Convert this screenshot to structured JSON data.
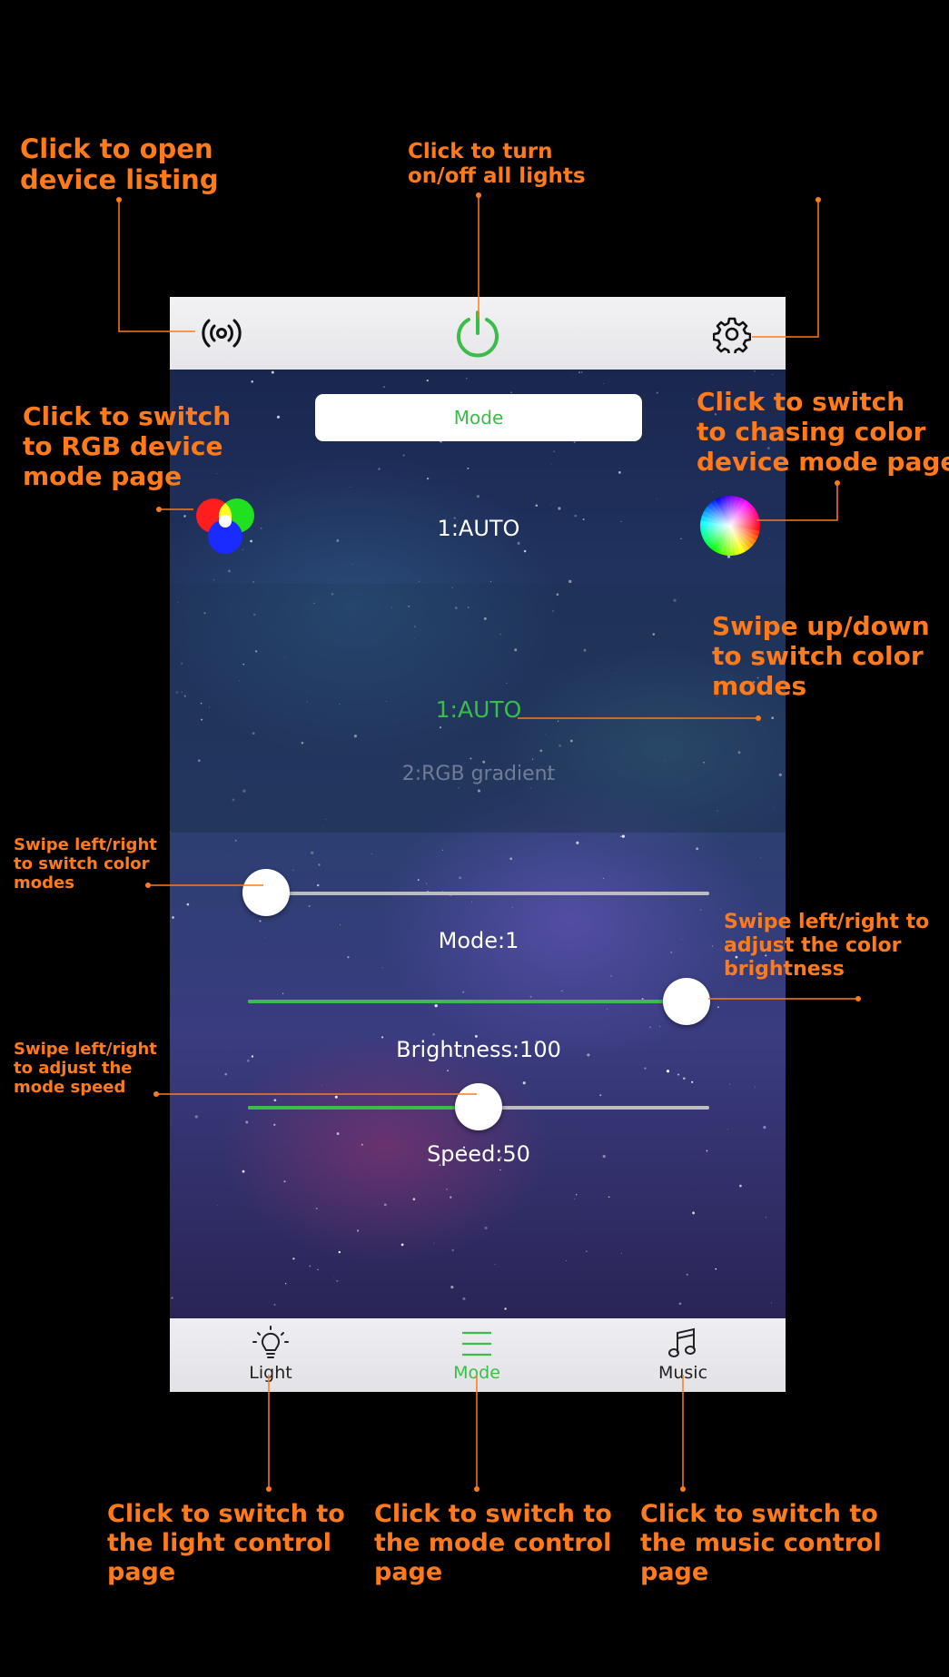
{
  "app": {
    "mode_button": "Mode",
    "current_mode": "1:AUTO",
    "picker": {
      "selected": "1:AUTO",
      "next": "2:RGB gradient"
    },
    "sliders": {
      "mode": {
        "label": "Mode:1",
        "value": 0.04
      },
      "brightness": {
        "label": "Brightness:100",
        "value": 0.95
      },
      "speed": {
        "label": "Speed:50",
        "value": 0.5
      }
    },
    "tabs": [
      {
        "label": "Light",
        "icon": "bulb-icon"
      },
      {
        "label": "Mode",
        "icon": "menu-icon",
        "active": true
      },
      {
        "label": "Music",
        "icon": "music-note-icon"
      }
    ]
  },
  "colors": {
    "accent_green": "#3bbd4a",
    "annotation_orange": "#ff7a1a"
  },
  "icons": {
    "top_left": "radio-signal-icon",
    "top_center": "power-icon",
    "top_right": "gear-icon",
    "left_mode": "rgb-circles-icon",
    "right_mode": "color-wheel-icon"
  },
  "annotations": {
    "device_listing": [
      "Click to open",
      "device listing"
    ],
    "power": [
      "Click to turn",
      "on/off all lights"
    ],
    "rgb_mode": [
      "Click to switch",
      "to RGB device",
      "mode page"
    ],
    "chasing_mode": [
      "Click to switch",
      "to chasing color",
      "device mode page"
    ],
    "swipe_modes": [
      "Swipe up/down",
      "to switch color",
      "modes"
    ],
    "swipe_lr_modes": [
      "Swipe left/right",
      "to switch color",
      "modes"
    ],
    "swipe_brightness": [
      "Swipe left/right to",
      "adjust the color",
      "brightness"
    ],
    "swipe_speed": [
      "Swipe left/right",
      "to adjust the",
      "mode speed"
    ],
    "light_page": [
      "Click to switch to",
      "the light control",
      "page"
    ],
    "mode_page": [
      "Click to switch to",
      "the mode control",
      "page"
    ],
    "music_page": [
      "Click to switch to",
      "the music control",
      "page"
    ]
  }
}
